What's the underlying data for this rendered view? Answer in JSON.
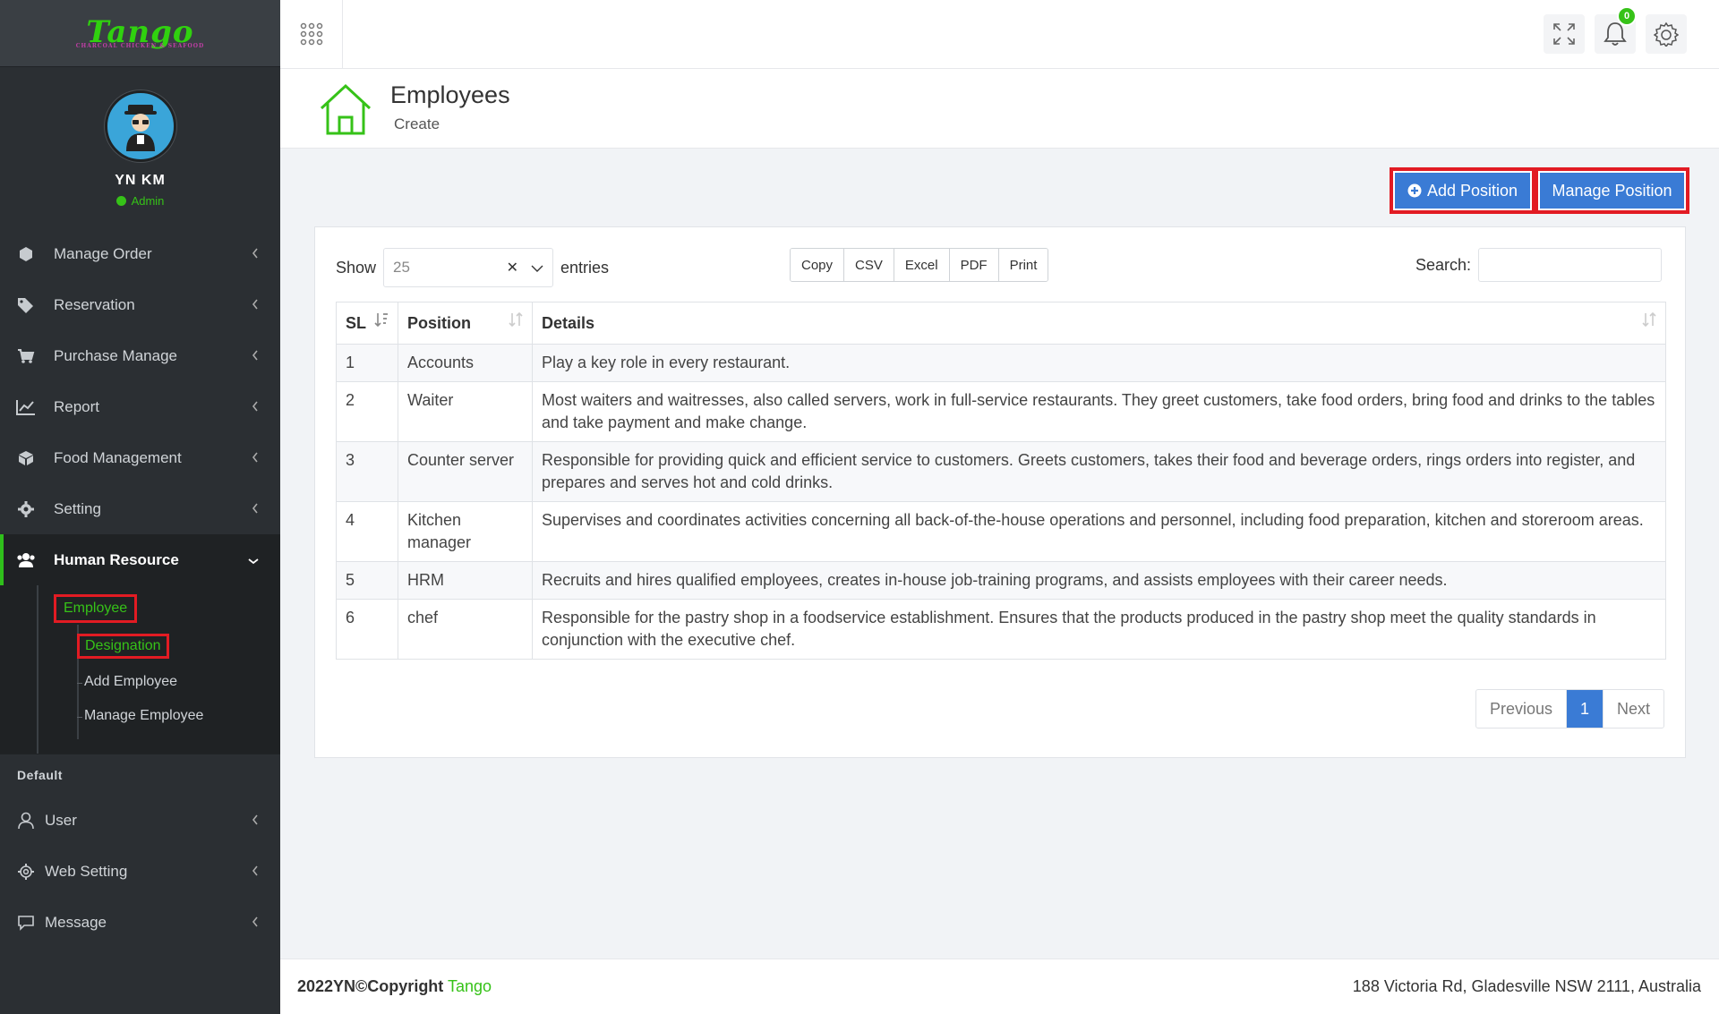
{
  "brand": {
    "name": "Tango",
    "tagline": "CHARCOAL CHICKEN & SEAFOOD"
  },
  "profile": {
    "name": "YN KM",
    "role": "Admin"
  },
  "sidebar": {
    "items": [
      {
        "label": "Manage Order",
        "icon": "cube-icon"
      },
      {
        "label": "Reservation",
        "icon": "tags-icon"
      },
      {
        "label": "Purchase Manage",
        "icon": "cart-icon"
      },
      {
        "label": "Report",
        "icon": "chart-icon"
      },
      {
        "label": "Food Management",
        "icon": "box-icon"
      },
      {
        "label": "Setting",
        "icon": "gear-icon"
      },
      {
        "label": "Human Resource",
        "icon": "users-icon"
      }
    ],
    "submenu": {
      "employee": "Employee",
      "designation": "Designation",
      "add_employee": "Add Employee",
      "manage_employee": "Manage Employee"
    },
    "section_label": "Default",
    "items2": [
      {
        "label": "User",
        "icon": "user-icon"
      },
      {
        "label": "Web Setting",
        "icon": "settings-icon"
      },
      {
        "label": "Message",
        "icon": "message-icon"
      }
    ]
  },
  "topbar": {
    "notification_count": "0"
  },
  "page": {
    "title": "Employees",
    "subtitle": "Create"
  },
  "actions": {
    "add_position": "Add Position",
    "manage_position": "Manage Position"
  },
  "controls": {
    "show_label": "Show",
    "page_size": "25",
    "entries_label": "entries",
    "export_buttons": [
      "Copy",
      "CSV",
      "Excel",
      "PDF",
      "Print"
    ],
    "search_label": "Search:"
  },
  "table": {
    "headers": [
      "SL",
      "Position",
      "Details"
    ],
    "rows": [
      {
        "sl": "1",
        "position": "Accounts",
        "details": "Play a key role in every restaurant."
      },
      {
        "sl": "2",
        "position": "Waiter",
        "details": "Most waiters and waitresses, also called servers, work in full-service restaurants. They greet customers, take food orders, bring food and drinks to the tables and take payment and make change."
      },
      {
        "sl": "3",
        "position": "Counter server",
        "details": "Responsible for providing quick and efficient service to customers. Greets customers, takes their food and beverage orders, rings orders into register, and prepares and serves hot and cold drinks."
      },
      {
        "sl": "4",
        "position": "Kitchen manager",
        "details": "Supervises and coordinates activities concerning all back-of-the-house operations and personnel, including food preparation, kitchen and storeroom areas."
      },
      {
        "sl": "5",
        "position": "HRM",
        "details": "Recruits and hires qualified employees, creates in-house job-training programs, and assists employees with their career needs."
      },
      {
        "sl": "6",
        "position": "chef",
        "details": "Responsible for the pastry shop in a foodservice establishment. Ensures that the products produced in the pastry shop meet the quality standards in conjunction with the executive chef."
      }
    ]
  },
  "pagination": {
    "previous": "Previous",
    "current": "1",
    "next": "Next"
  },
  "footer": {
    "copyright": "2022YN©Copyright",
    "brand": "Tango",
    "address": "188 Victoria Rd, Gladesville NSW 2111, Australia"
  },
  "colors": {
    "accent": "#3a7bd5",
    "brand_green": "#36c218",
    "sidebar_bg": "#2b2f33",
    "highlight": "#e21b23"
  }
}
